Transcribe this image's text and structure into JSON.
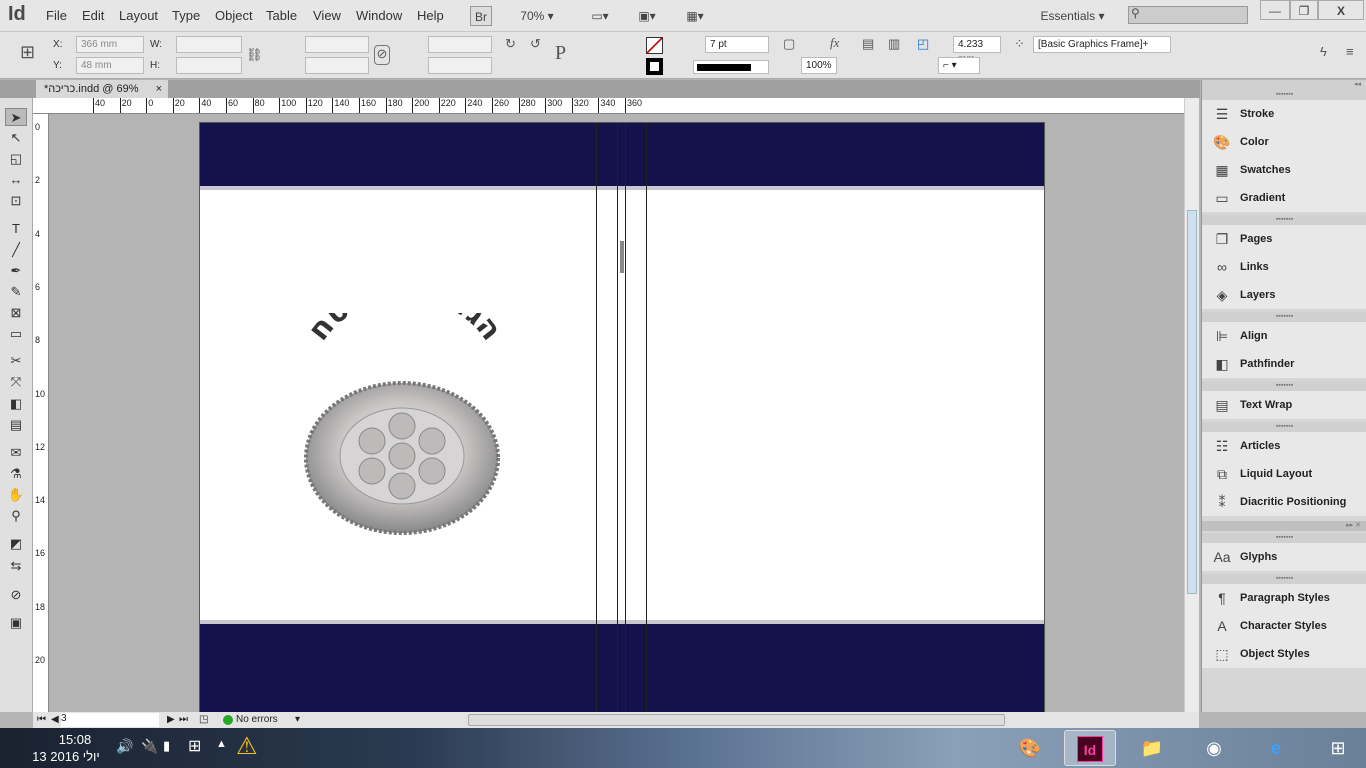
{
  "app": {
    "logo": "Id",
    "menus": [
      "File",
      "Edit",
      "Layout",
      "Type",
      "Object",
      "Table",
      "View",
      "Window",
      "Help"
    ],
    "bridge": "Br",
    "zoom": "70%",
    "workspace": "Essentials",
    "search_placeholder": ""
  },
  "window": {
    "minimize": "—",
    "restore": "❐",
    "close": "X"
  },
  "control": {
    "x_label": "X:",
    "x_value": "366 mm",
    "y_label": "Y:",
    "y_value": "48 mm",
    "w_label": "W:",
    "h_label": "H:",
    "stroke_weight": "7 pt",
    "opacity": "100%",
    "offset": "4.233 mm",
    "object_style": "[Basic Graphics Frame]+"
  },
  "document": {
    "tab": "*כריכה.indd @ 69%",
    "close": "×",
    "title_art": "הגדה של פסח"
  },
  "ruler": {
    "h_ticks": [
      "40",
      "20",
      "0",
      "20",
      "40",
      "60",
      "80",
      "100",
      "120",
      "140",
      "160",
      "180",
      "200",
      "220",
      "240",
      "260",
      "280",
      "300",
      "320",
      "340",
      "360"
    ],
    "v_ticks": [
      "0",
      "2",
      "4",
      "6",
      "8",
      "10",
      "12",
      "14",
      "16",
      "18",
      "20"
    ]
  },
  "panels": {
    "groups": [
      [
        {
          "icon": "stroke-icon",
          "glyph": "☰",
          "label": "Stroke"
        },
        {
          "icon": "color-icon",
          "glyph": "🎨",
          "label": "Color"
        },
        {
          "icon": "swatches-icon",
          "glyph": "▦",
          "label": "Swatches"
        },
        {
          "icon": "gradient-icon",
          "glyph": "▭",
          "label": "Gradient"
        }
      ],
      [
        {
          "icon": "pages-icon",
          "glyph": "❐",
          "label": "Pages"
        },
        {
          "icon": "links-icon",
          "glyph": "∞",
          "label": "Links"
        },
        {
          "icon": "layers-icon",
          "glyph": "◈",
          "label": "Layers"
        }
      ],
      [
        {
          "icon": "align-icon",
          "glyph": "⊫",
          "label": "Align"
        },
        {
          "icon": "pathfinder-icon",
          "glyph": "◧",
          "label": "Pathfinder"
        }
      ],
      [
        {
          "icon": "text-wrap-icon",
          "glyph": "▤",
          "label": "Text Wrap"
        }
      ],
      [
        {
          "icon": "articles-icon",
          "glyph": "☷",
          "label": "Articles"
        },
        {
          "icon": "liquid-layout-icon",
          "glyph": "⧉",
          "label": "Liquid Layout"
        },
        {
          "icon": "diacritic-icon",
          "glyph": "⁑",
          "label": "Diacritic Positioning"
        }
      ],
      [
        {
          "icon": "glyphs-icon",
          "glyph": "Aa",
          "label": "Glyphs"
        }
      ],
      [
        {
          "icon": "paragraph-styles-icon",
          "glyph": "¶",
          "label": "Paragraph Styles"
        },
        {
          "icon": "character-styles-icon",
          "glyph": "A",
          "label": "Character Styles"
        },
        {
          "icon": "object-styles-icon",
          "glyph": "⬚",
          "label": "Object Styles"
        }
      ]
    ]
  },
  "status": {
    "page": "3",
    "preflight": "No errors"
  },
  "taskbar": {
    "time": "15:08",
    "date": "13 יולי 2016"
  },
  "colors": {
    "navy": "#14124a",
    "ok": "#22aa22"
  }
}
